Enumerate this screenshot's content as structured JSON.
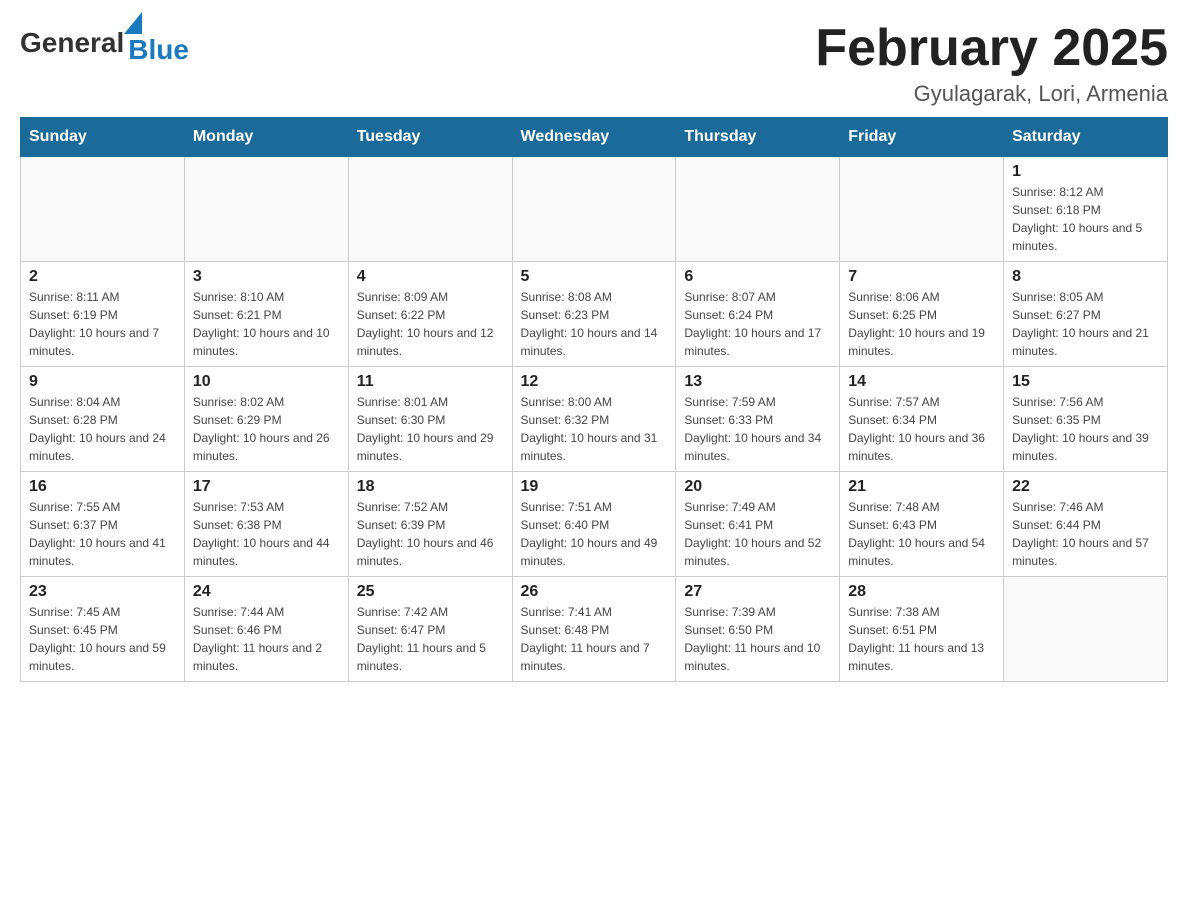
{
  "header": {
    "logo": {
      "general": "General",
      "blue": "Blue"
    },
    "title": "February 2025",
    "subtitle": "Gyulagarak, Lori, Armenia"
  },
  "days_of_week": [
    "Sunday",
    "Monday",
    "Tuesday",
    "Wednesday",
    "Thursday",
    "Friday",
    "Saturday"
  ],
  "weeks": [
    [
      {
        "day": "",
        "info": ""
      },
      {
        "day": "",
        "info": ""
      },
      {
        "day": "",
        "info": ""
      },
      {
        "day": "",
        "info": ""
      },
      {
        "day": "",
        "info": ""
      },
      {
        "day": "",
        "info": ""
      },
      {
        "day": "1",
        "info": "Sunrise: 8:12 AM\nSunset: 6:18 PM\nDaylight: 10 hours and 5 minutes."
      }
    ],
    [
      {
        "day": "2",
        "info": "Sunrise: 8:11 AM\nSunset: 6:19 PM\nDaylight: 10 hours and 7 minutes."
      },
      {
        "day": "3",
        "info": "Sunrise: 8:10 AM\nSunset: 6:21 PM\nDaylight: 10 hours and 10 minutes."
      },
      {
        "day": "4",
        "info": "Sunrise: 8:09 AM\nSunset: 6:22 PM\nDaylight: 10 hours and 12 minutes."
      },
      {
        "day": "5",
        "info": "Sunrise: 8:08 AM\nSunset: 6:23 PM\nDaylight: 10 hours and 14 minutes."
      },
      {
        "day": "6",
        "info": "Sunrise: 8:07 AM\nSunset: 6:24 PM\nDaylight: 10 hours and 17 minutes."
      },
      {
        "day": "7",
        "info": "Sunrise: 8:06 AM\nSunset: 6:25 PM\nDaylight: 10 hours and 19 minutes."
      },
      {
        "day": "8",
        "info": "Sunrise: 8:05 AM\nSunset: 6:27 PM\nDaylight: 10 hours and 21 minutes."
      }
    ],
    [
      {
        "day": "9",
        "info": "Sunrise: 8:04 AM\nSunset: 6:28 PM\nDaylight: 10 hours and 24 minutes."
      },
      {
        "day": "10",
        "info": "Sunrise: 8:02 AM\nSunset: 6:29 PM\nDaylight: 10 hours and 26 minutes."
      },
      {
        "day": "11",
        "info": "Sunrise: 8:01 AM\nSunset: 6:30 PM\nDaylight: 10 hours and 29 minutes."
      },
      {
        "day": "12",
        "info": "Sunrise: 8:00 AM\nSunset: 6:32 PM\nDaylight: 10 hours and 31 minutes."
      },
      {
        "day": "13",
        "info": "Sunrise: 7:59 AM\nSunset: 6:33 PM\nDaylight: 10 hours and 34 minutes."
      },
      {
        "day": "14",
        "info": "Sunrise: 7:57 AM\nSunset: 6:34 PM\nDaylight: 10 hours and 36 minutes."
      },
      {
        "day": "15",
        "info": "Sunrise: 7:56 AM\nSunset: 6:35 PM\nDaylight: 10 hours and 39 minutes."
      }
    ],
    [
      {
        "day": "16",
        "info": "Sunrise: 7:55 AM\nSunset: 6:37 PM\nDaylight: 10 hours and 41 minutes."
      },
      {
        "day": "17",
        "info": "Sunrise: 7:53 AM\nSunset: 6:38 PM\nDaylight: 10 hours and 44 minutes."
      },
      {
        "day": "18",
        "info": "Sunrise: 7:52 AM\nSunset: 6:39 PM\nDaylight: 10 hours and 46 minutes."
      },
      {
        "day": "19",
        "info": "Sunrise: 7:51 AM\nSunset: 6:40 PM\nDaylight: 10 hours and 49 minutes."
      },
      {
        "day": "20",
        "info": "Sunrise: 7:49 AM\nSunset: 6:41 PM\nDaylight: 10 hours and 52 minutes."
      },
      {
        "day": "21",
        "info": "Sunrise: 7:48 AM\nSunset: 6:43 PM\nDaylight: 10 hours and 54 minutes."
      },
      {
        "day": "22",
        "info": "Sunrise: 7:46 AM\nSunset: 6:44 PM\nDaylight: 10 hours and 57 minutes."
      }
    ],
    [
      {
        "day": "23",
        "info": "Sunrise: 7:45 AM\nSunset: 6:45 PM\nDaylight: 10 hours and 59 minutes."
      },
      {
        "day": "24",
        "info": "Sunrise: 7:44 AM\nSunset: 6:46 PM\nDaylight: 11 hours and 2 minutes."
      },
      {
        "day": "25",
        "info": "Sunrise: 7:42 AM\nSunset: 6:47 PM\nDaylight: 11 hours and 5 minutes."
      },
      {
        "day": "26",
        "info": "Sunrise: 7:41 AM\nSunset: 6:48 PM\nDaylight: 11 hours and 7 minutes."
      },
      {
        "day": "27",
        "info": "Sunrise: 7:39 AM\nSunset: 6:50 PM\nDaylight: 11 hours and 10 minutes."
      },
      {
        "day": "28",
        "info": "Sunrise: 7:38 AM\nSunset: 6:51 PM\nDaylight: 11 hours and 13 minutes."
      },
      {
        "day": "",
        "info": ""
      }
    ]
  ]
}
